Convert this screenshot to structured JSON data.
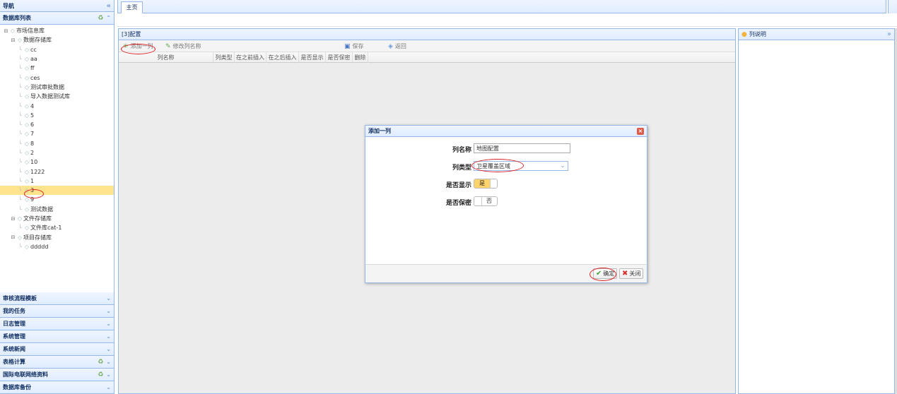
{
  "nav": {
    "title": "导航",
    "collapse_glyph": "«",
    "db_list_title": "数据库列表",
    "tree": [
      {
        "label": "市场信息库",
        "level": 0,
        "expander": "⊟"
      },
      {
        "label": "数据存储库",
        "level": 1,
        "expander": "⊟"
      },
      {
        "label": "cc",
        "level": 2
      },
      {
        "label": "aa",
        "level": 2
      },
      {
        "label": "ff",
        "level": 2
      },
      {
        "label": "ces",
        "level": 2
      },
      {
        "label": "测试审批数据",
        "level": 2
      },
      {
        "label": "导入数据测试库",
        "level": 2
      },
      {
        "label": "4",
        "level": 2
      },
      {
        "label": "5",
        "level": 2
      },
      {
        "label": "6",
        "level": 2
      },
      {
        "label": "7",
        "level": 2
      },
      {
        "label": "8",
        "level": 2
      },
      {
        "label": "2",
        "level": 2
      },
      {
        "label": "10",
        "level": 2
      },
      {
        "label": "1222",
        "level": 2
      },
      {
        "label": "1",
        "level": 2
      },
      {
        "label": "3",
        "level": 2,
        "selected": true
      },
      {
        "label": "9",
        "level": 2
      },
      {
        "label": "测试数据",
        "level": 2
      },
      {
        "label": "文件存储库",
        "level": 1,
        "expander": "⊟"
      },
      {
        "label": "文件库cat-1",
        "level": 2
      },
      {
        "label": "项目存储库",
        "level": 1,
        "expander": "⊟"
      },
      {
        "label": "ddddd",
        "level": 2
      }
    ],
    "accordion": [
      {
        "label": "审核流程模板",
        "refresh": false
      },
      {
        "label": "我的任务",
        "refresh": false
      },
      {
        "label": "日志管理",
        "refresh": false
      },
      {
        "label": "系统管理",
        "refresh": false
      },
      {
        "label": "系统新闻",
        "refresh": false
      },
      {
        "label": "表格计算",
        "refresh": true
      },
      {
        "label": "国际电联网络资料",
        "refresh": true
      },
      {
        "label": "数据库备份",
        "refresh": false
      }
    ]
  },
  "tabs": {
    "home": "主页"
  },
  "config": {
    "title": "[3]配置",
    "toolbar": {
      "add_column": "添加一列",
      "rename_column": "修改列名称",
      "save": "保存",
      "back": "返回"
    },
    "columns": [
      "列名称",
      "列类型",
      "在之前插入",
      "在之后插入",
      "是否显示",
      "是否保密",
      "删除"
    ]
  },
  "desc_panel": {
    "title": "列说明",
    "expand_glyph": "»"
  },
  "dialog": {
    "title": "添加一列",
    "name_label": "列名称",
    "name_value": "地图配置",
    "type_label": "列类型",
    "type_value": "卫星覆盖区域",
    "show_label": "是否显示",
    "show_value": "是",
    "secret_label": "是否保密",
    "secret_value": "否",
    "ok": "确定",
    "close": "关闭"
  },
  "colors": {
    "accent_border": "#95b8e7",
    "selected_row": "#ffe48d",
    "annotation": "#dd2222"
  }
}
